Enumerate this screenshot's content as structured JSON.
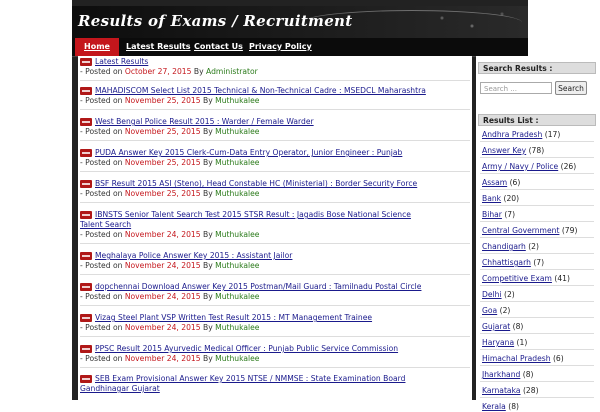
{
  "site": {
    "title": "Results of Exams / Recruitment"
  },
  "nav": [
    {
      "label": "Home"
    },
    {
      "label": "Latest Results"
    },
    {
      "label": "Contact Us"
    },
    {
      "label": "Privacy Policy"
    }
  ],
  "posts": [
    {
      "title": "Latest Results",
      "title2": "",
      "posted_prefix": "- Posted on",
      "date": "October 27, 2015",
      "by": "By",
      "author": "Administrator"
    },
    {
      "title": "MAHADISCOM Select List 2015 Technical & Non-Technical Cadre : MSEDCL Maharashtra",
      "title2": "",
      "posted_prefix": "- Posted on",
      "date": "November 25, 2015",
      "by": "By",
      "author": "Muthukalee"
    },
    {
      "title": "West Bengal Police Result 2015 : Warder / Female Warder",
      "title2": "",
      "posted_prefix": "- Posted on",
      "date": "November 25, 2015",
      "by": "By",
      "author": "Muthukalee"
    },
    {
      "title": "PUDA Answer Key 2015 Clerk-Cum-Data Entry Operator, Junior Engineer : Punjab",
      "title2": "",
      "posted_prefix": "- Posted on",
      "date": "November 25, 2015",
      "by": "By",
      "author": "Muthukalee"
    },
    {
      "title": "BSF Result 2015 ASI (Steno), Head Constable HC (Ministerial) : Border Security Force",
      "title2": "",
      "posted_prefix": "- Posted on",
      "date": "November 25, 2015",
      "by": "By",
      "author": "Muthukalee"
    },
    {
      "title": "IBNSTS Senior Talent Search Test 2015 STSR Result : Jagadis Bose National Science",
      "title2": "Talent Search",
      "posted_prefix": "- Posted on",
      "date": "November 24, 2015",
      "by": "By",
      "author": "Muthukalee"
    },
    {
      "title": "Meghalaya Police Answer Key 2015 : Assistant Jailor",
      "title2": "",
      "posted_prefix": "- Posted on",
      "date": "November 24, 2015",
      "by": "By",
      "author": "Muthukalee"
    },
    {
      "title": "dopchennai Download Answer Key 2015 Postman/Mail Guard : Tamilnadu Postal Circle",
      "title2": "",
      "posted_prefix": "- Posted on",
      "date": "November 24, 2015",
      "by": "By",
      "author": "Muthukalee"
    },
    {
      "title": "Vizag Steel Plant VSP Written Test Result 2015 : MT Management Trainee",
      "title2": "",
      "posted_prefix": "- Posted on",
      "date": "November 24, 2015",
      "by": "By",
      "author": "Muthukalee"
    },
    {
      "title": "PPSC Result 2015 Ayurvedic Medical Officer : Punjab Public Service Commission",
      "title2": "",
      "posted_prefix": "- Posted on",
      "date": "November 24, 2015",
      "by": "By",
      "author": "Muthukalee"
    },
    {
      "title": "SEB Exam Provisional Answer Key 2015 NTSE / NMMSE : State Examination Board",
      "title2": "Gandhinagar Gujarat",
      "posted_prefix": "",
      "date": "",
      "by": "",
      "author": ""
    }
  ],
  "sidebar": {
    "search_heading": "Search Results :",
    "search_placeholder": "Search ...",
    "search_button": "Search",
    "list_heading": "Results List :",
    "categories": [
      {
        "name": "Andhra Pradesh",
        "count": "(17)"
      },
      {
        "name": "Answer Key",
        "count": "(78)"
      },
      {
        "name": "Army / Navy / Police",
        "count": "(26)"
      },
      {
        "name": "Assam",
        "count": "(6)"
      },
      {
        "name": "Bank",
        "count": "(20)"
      },
      {
        "name": "Bihar",
        "count": "(7)"
      },
      {
        "name": "Central Government",
        "count": "(79)"
      },
      {
        "name": "Chandigarh",
        "count": "(2)"
      },
      {
        "name": "Chhattisgarh",
        "count": "(7)"
      },
      {
        "name": "Competitive Exam",
        "count": "(41)"
      },
      {
        "name": "Delhi",
        "count": "(2)"
      },
      {
        "name": "Goa",
        "count": "(2)"
      },
      {
        "name": "Gujarat",
        "count": "(8)"
      },
      {
        "name": "Haryana",
        "count": "(1)"
      },
      {
        "name": "Himachal Pradesh",
        "count": "(6)"
      },
      {
        "name": "Jharkhand",
        "count": "(8)"
      },
      {
        "name": "Karnataka",
        "count": "(28)"
      },
      {
        "name": "Kerala",
        "count": "(8)"
      }
    ]
  }
}
